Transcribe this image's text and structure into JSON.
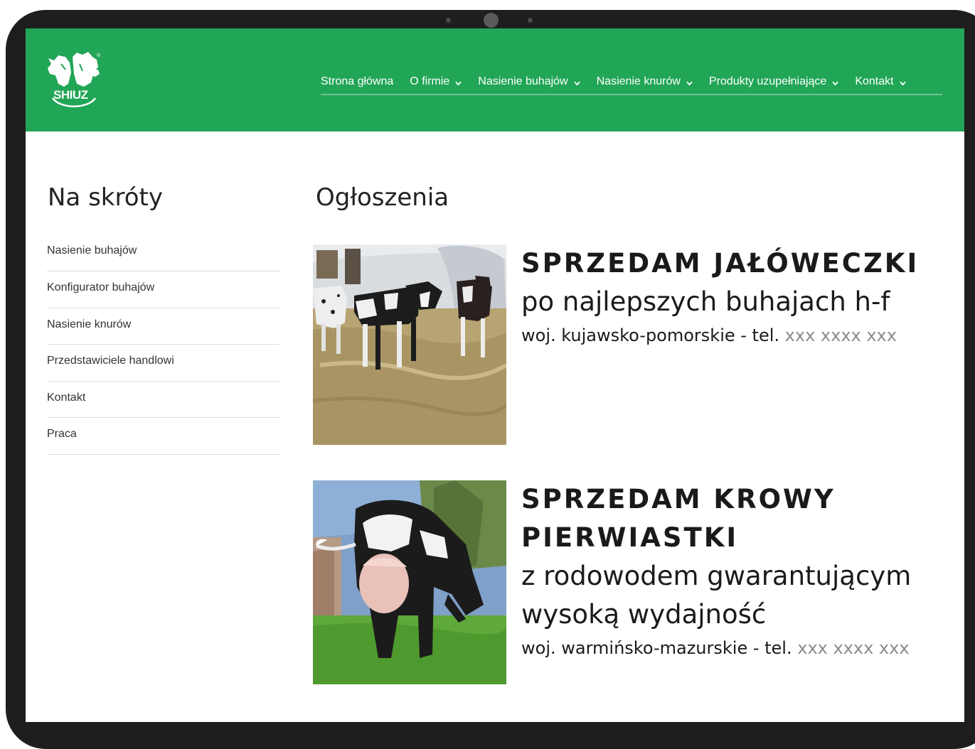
{
  "header": {
    "logo_text": "SHIUZ",
    "nav": [
      {
        "label": "Strona główna",
        "has_dropdown": false
      },
      {
        "label": "O firmie",
        "has_dropdown": true
      },
      {
        "label": "Nasienie buhajów",
        "has_dropdown": true
      },
      {
        "label": "Nasienie knurów",
        "has_dropdown": true
      },
      {
        "label": "Produkty uzupełniające",
        "has_dropdown": true
      },
      {
        "label": "Kontakt",
        "has_dropdown": true
      }
    ]
  },
  "sidebar": {
    "title": "Na skróty",
    "items": [
      {
        "label": "Nasienie buhajów"
      },
      {
        "label": "Konfigurator buhajów"
      },
      {
        "label": "Nasienie knurów"
      },
      {
        "label": "Przedstawiciele handlowi"
      },
      {
        "label": "Kontakt"
      },
      {
        "label": "Praca"
      }
    ]
  },
  "main": {
    "title": "Ogłoszenia",
    "ads": [
      {
        "headline": "SPRZEDAM JAŁÓWECZKI",
        "subtitle": "po najlepszych buhajach h-f",
        "region": "woj. kujawsko-pomorskie - tel.",
        "phone": "xxx xxxx xxx"
      },
      {
        "headline": "SPRZEDAM KROWY PIERWIASTKI",
        "subtitle": "z rodowodem gwarantującym wysoką wydajność",
        "region": "woj. warmińsko-mazurskie - tel.",
        "phone": "xxx xxxx xxx"
      }
    ]
  },
  "colors": {
    "header_green": "#21a556",
    "device_frame": "#1e1e1e",
    "phone_gray": "#8c8c8c"
  },
  "icons": {
    "dropdown": "chevron-down-icon",
    "logo": "shiuz-logo-icon"
  }
}
